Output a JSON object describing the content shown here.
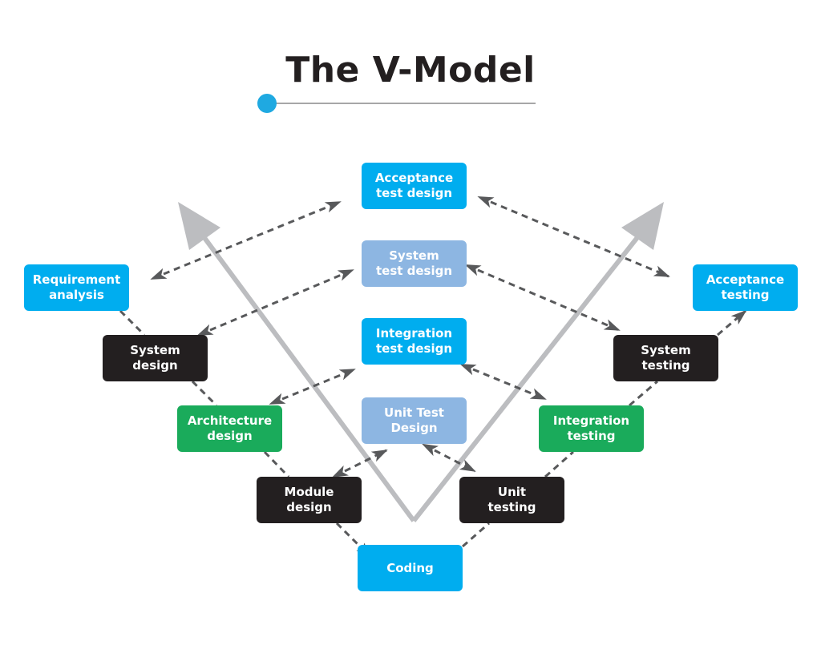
{
  "title": "The V-Model",
  "colors": {
    "blue": "#00adef",
    "light_blue": "#8db6e2",
    "black": "#231f20",
    "green": "#1aab5b",
    "accent_dot": "#1fa9e1",
    "arrow_gray": "#bcbdc0",
    "dash_gray": "#58595b"
  },
  "nodes": {
    "acceptance_test_design": "Acceptance\ntest design",
    "system_test_design": "System\ntest design",
    "integration_test_design": "Integration\ntest design",
    "unit_test_design": "Unit Test\nDesign",
    "requirement_analysis": "Requirement\nanalysis",
    "system_design": "System\ndesign",
    "architecture_design": "Architecture\ndesign",
    "module_design": "Module\ndesign",
    "coding": "Coding",
    "unit_testing": "Unit\ntesting",
    "integration_testing": "Integration\ntesting",
    "system_testing": "System\ntesting",
    "acceptance_testing": "Acceptance\ntesting"
  }
}
